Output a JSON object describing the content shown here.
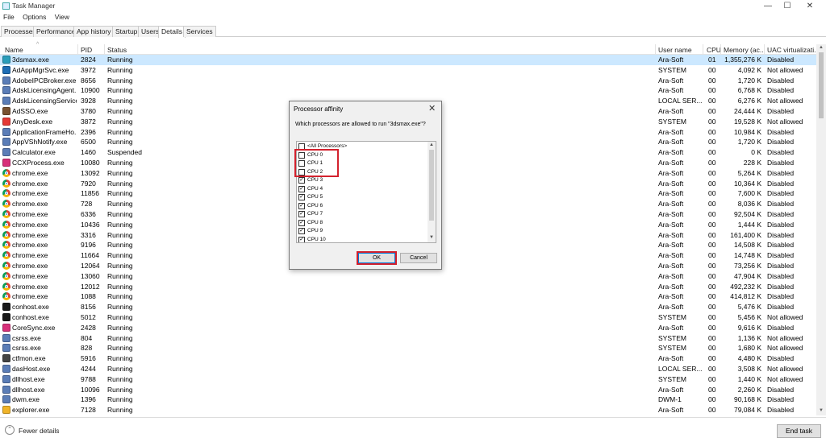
{
  "window": {
    "title": "Task Manager",
    "minimize": "—",
    "maximize": "☐",
    "close": "✕"
  },
  "menu": [
    "File",
    "Options",
    "View"
  ],
  "tabs": [
    "Processes",
    "Performance",
    "App history",
    "Startup",
    "Users",
    "Details",
    "Services"
  ],
  "active_tab": 5,
  "columns": {
    "name": "Name",
    "pid": "PID",
    "status": "Status",
    "user": "User name",
    "cpu": "CPU",
    "mem": "Memory (ac...",
    "uac": "UAC virtualizati..."
  },
  "processes": [
    {
      "name": "3dsmax.exe",
      "pid": "2824",
      "status": "Running",
      "user": "Ara-Soft",
      "cpu": "01",
      "mem": "1,355,276 K",
      "uac": "Disabled",
      "icon": "#2a9dba",
      "selected": true
    },
    {
      "name": "AdAppMgrSvc.exe",
      "pid": "3972",
      "status": "Running",
      "user": "SYSTEM",
      "cpu": "00",
      "mem": "4,092 K",
      "uac": "Not allowed",
      "icon": "#1e6db5"
    },
    {
      "name": "AdobeIPCBroker.exe",
      "pid": "8656",
      "status": "Running",
      "user": "Ara-Soft",
      "cpu": "00",
      "mem": "1,720 K",
      "uac": "Disabled",
      "icon": "#5b7db7"
    },
    {
      "name": "AdskLicensingAgent...",
      "pid": "10900",
      "status": "Running",
      "user": "Ara-Soft",
      "cpu": "00",
      "mem": "6,768 K",
      "uac": "Disabled",
      "icon": "#5b7db7"
    },
    {
      "name": "AdskLicensingService...",
      "pid": "3928",
      "status": "Running",
      "user": "LOCAL SER...",
      "cpu": "00",
      "mem": "6,276 K",
      "uac": "Not allowed",
      "icon": "#5b7db7"
    },
    {
      "name": "AdSSO.exe",
      "pid": "3780",
      "status": "Running",
      "user": "Ara-Soft",
      "cpu": "00",
      "mem": "24,444 K",
      "uac": "Disabled",
      "icon": "#7a5230"
    },
    {
      "name": "AnyDesk.exe",
      "pid": "3872",
      "status": "Running",
      "user": "SYSTEM",
      "cpu": "00",
      "mem": "19,528 K",
      "uac": "Not allowed",
      "icon": "#e53935"
    },
    {
      "name": "ApplicationFrameHo...",
      "pid": "2396",
      "status": "Running",
      "user": "Ara-Soft",
      "cpu": "00",
      "mem": "10,984 K",
      "uac": "Disabled",
      "icon": "#5b7db7"
    },
    {
      "name": "AppVShNotify.exe",
      "pid": "6500",
      "status": "Running",
      "user": "Ara-Soft",
      "cpu": "00",
      "mem": "1,720 K",
      "uac": "Disabled",
      "icon": "#5b7db7"
    },
    {
      "name": "Calculator.exe",
      "pid": "1460",
      "status": "Suspended",
      "user": "Ara-Soft",
      "cpu": "00",
      "mem": "0 K",
      "uac": "Disabled",
      "icon": "#5b7db7"
    },
    {
      "name": "CCXProcess.exe",
      "pid": "10080",
      "status": "Running",
      "user": "Ara-Soft",
      "cpu": "00",
      "mem": "228 K",
      "uac": "Disabled",
      "icon": "#d8307a"
    },
    {
      "name": "chrome.exe",
      "pid": "13092",
      "status": "Running",
      "user": "Ara-Soft",
      "cpu": "00",
      "mem": "5,264 K",
      "uac": "Disabled",
      "icon": "chrome"
    },
    {
      "name": "chrome.exe",
      "pid": "7920",
      "status": "Running",
      "user": "Ara-Soft",
      "cpu": "00",
      "mem": "10,364 K",
      "uac": "Disabled",
      "icon": "chrome"
    },
    {
      "name": "chrome.exe",
      "pid": "11856",
      "status": "Running",
      "user": "Ara-Soft",
      "cpu": "00",
      "mem": "7,600 K",
      "uac": "Disabled",
      "icon": "chrome"
    },
    {
      "name": "chrome.exe",
      "pid": "728",
      "status": "Running",
      "user": "Ara-Soft",
      "cpu": "00",
      "mem": "8,036 K",
      "uac": "Disabled",
      "icon": "chrome"
    },
    {
      "name": "chrome.exe",
      "pid": "6336",
      "status": "Running",
      "user": "Ara-Soft",
      "cpu": "00",
      "mem": "92,504 K",
      "uac": "Disabled",
      "icon": "chrome"
    },
    {
      "name": "chrome.exe",
      "pid": "10436",
      "status": "Running",
      "user": "Ara-Soft",
      "cpu": "00",
      "mem": "1,444 K",
      "uac": "Disabled",
      "icon": "chrome"
    },
    {
      "name": "chrome.exe",
      "pid": "3316",
      "status": "Running",
      "user": "Ara-Soft",
      "cpu": "00",
      "mem": "161,400 K",
      "uac": "Disabled",
      "icon": "chrome"
    },
    {
      "name": "chrome.exe",
      "pid": "9196",
      "status": "Running",
      "user": "Ara-Soft",
      "cpu": "00",
      "mem": "14,508 K",
      "uac": "Disabled",
      "icon": "chrome"
    },
    {
      "name": "chrome.exe",
      "pid": "11664",
      "status": "Running",
      "user": "Ara-Soft",
      "cpu": "00",
      "mem": "14,748 K",
      "uac": "Disabled",
      "icon": "chrome"
    },
    {
      "name": "chrome.exe",
      "pid": "12064",
      "status": "Running",
      "user": "Ara-Soft",
      "cpu": "00",
      "mem": "73,256 K",
      "uac": "Disabled",
      "icon": "chrome"
    },
    {
      "name": "chrome.exe",
      "pid": "13060",
      "status": "Running",
      "user": "Ara-Soft",
      "cpu": "00",
      "mem": "47,904 K",
      "uac": "Disabled",
      "icon": "chrome"
    },
    {
      "name": "chrome.exe",
      "pid": "12012",
      "status": "Running",
      "user": "Ara-Soft",
      "cpu": "00",
      "mem": "492,232 K",
      "uac": "Disabled",
      "icon": "chrome"
    },
    {
      "name": "chrome.exe",
      "pid": "1088",
      "status": "Running",
      "user": "Ara-Soft",
      "cpu": "00",
      "mem": "414,812 K",
      "uac": "Disabled",
      "icon": "chrome"
    },
    {
      "name": "conhost.exe",
      "pid": "8156",
      "status": "Running",
      "user": "Ara-Soft",
      "cpu": "00",
      "mem": "5,476 K",
      "uac": "Disabled",
      "icon": "#1a1a1a"
    },
    {
      "name": "conhost.exe",
      "pid": "5012",
      "status": "Running",
      "user": "SYSTEM",
      "cpu": "00",
      "mem": "5,456 K",
      "uac": "Not allowed",
      "icon": "#1a1a1a"
    },
    {
      "name": "CoreSync.exe",
      "pid": "2428",
      "status": "Running",
      "user": "Ara-Soft",
      "cpu": "00",
      "mem": "9,616 K",
      "uac": "Disabled",
      "icon": "#d8307a"
    },
    {
      "name": "csrss.exe",
      "pid": "804",
      "status": "Running",
      "user": "SYSTEM",
      "cpu": "00",
      "mem": "1,136 K",
      "uac": "Not allowed",
      "icon": "#5b7db7"
    },
    {
      "name": "csrss.exe",
      "pid": "828",
      "status": "Running",
      "user": "SYSTEM",
      "cpu": "00",
      "mem": "1,680 K",
      "uac": "Not allowed",
      "icon": "#5b7db7"
    },
    {
      "name": "ctfmon.exe",
      "pid": "5916",
      "status": "Running",
      "user": "Ara-Soft",
      "cpu": "00",
      "mem": "4,480 K",
      "uac": "Disabled",
      "icon": "#444"
    },
    {
      "name": "dasHost.exe",
      "pid": "4244",
      "status": "Running",
      "user": "LOCAL SER...",
      "cpu": "00",
      "mem": "3,508 K",
      "uac": "Not allowed",
      "icon": "#5b7db7"
    },
    {
      "name": "dllhost.exe",
      "pid": "9788",
      "status": "Running",
      "user": "SYSTEM",
      "cpu": "00",
      "mem": "1,440 K",
      "uac": "Not allowed",
      "icon": "#5b7db7"
    },
    {
      "name": "dllhost.exe",
      "pid": "10096",
      "status": "Running",
      "user": "Ara-Soft",
      "cpu": "00",
      "mem": "2,260 K",
      "uac": "Disabled",
      "icon": "#5b7db7"
    },
    {
      "name": "dwm.exe",
      "pid": "1396",
      "status": "Running",
      "user": "DWM-1",
      "cpu": "00",
      "mem": "90,168 K",
      "uac": "Disabled",
      "icon": "#5b7db7"
    },
    {
      "name": "explorer.exe",
      "pid": "7128",
      "status": "Running",
      "user": "Ara-Soft",
      "cpu": "00",
      "mem": "79,084 K",
      "uac": "Disabled",
      "icon": "#f0b429"
    }
  ],
  "footer": {
    "fewer_details": "Fewer details",
    "end_task": "End task",
    "fewer_icon": "⌃"
  },
  "dialog": {
    "title": "Processor affinity",
    "close": "✕",
    "prompt": "Which processors are allowed to run \"3dsmax.exe\"?",
    "items": [
      {
        "label": "<All Processors>",
        "checked": false
      },
      {
        "label": "CPU 0",
        "checked": false
      },
      {
        "label": "CPU 1",
        "checked": false
      },
      {
        "label": "CPU 2",
        "checked": false
      },
      {
        "label": "CPU 3",
        "checked": true
      },
      {
        "label": "CPU 4",
        "checked": true
      },
      {
        "label": "CPU 5",
        "checked": true
      },
      {
        "label": "CPU 6",
        "checked": true
      },
      {
        "label": "CPU 7",
        "checked": true
      },
      {
        "label": "CPU 8",
        "checked": true
      },
      {
        "label": "CPU 9",
        "checked": true
      },
      {
        "label": "CPU 10",
        "checked": true
      }
    ],
    "ok": "OK",
    "cancel": "Cancel",
    "check_mark": "✓"
  },
  "colors": {
    "selection": "#cce8ff",
    "highlight": "#d3212d",
    "accent": "#0078d7"
  }
}
